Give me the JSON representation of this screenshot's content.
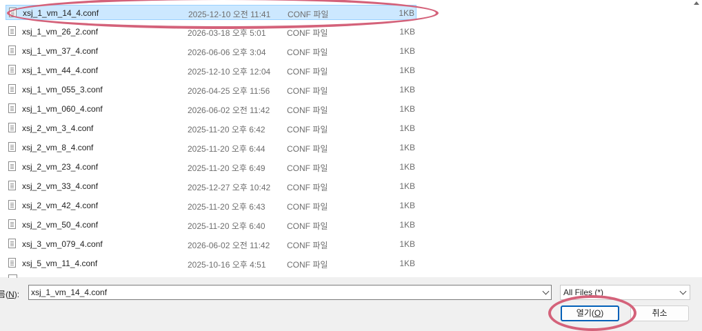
{
  "files": [
    {
      "name": "xsj_1_vm_14_4.conf",
      "date": "2025-12-10 오전 11:41",
      "type": "CONF 파일",
      "size": "1KB",
      "selected": true
    },
    {
      "name": "xsj_1_vm_26_2.conf",
      "date": "2026-03-18 오후 5:01",
      "type": "CONF 파일",
      "size": "1KB"
    },
    {
      "name": "xsj_1_vm_37_4.conf",
      "date": "2026-06-06 오후 3:04",
      "type": "CONF 파일",
      "size": "1KB"
    },
    {
      "name": "xsj_1_vm_44_4.conf",
      "date": "2025-12-10 오후 12:04",
      "type": "CONF 파일",
      "size": "1KB"
    },
    {
      "name": "xsj_1_vm_055_3.conf",
      "date": "2026-04-25 오후 11:56",
      "type": "CONF 파일",
      "size": "1KB"
    },
    {
      "name": "xsj_1_vm_060_4.conf",
      "date": "2026-06-02 오전 11:42",
      "type": "CONF 파일",
      "size": "1KB"
    },
    {
      "name": "xsj_2_vm_3_4.conf",
      "date": "2025-11-20 오후 6:42",
      "type": "CONF 파일",
      "size": "1KB"
    },
    {
      "name": "xsj_2_vm_8_4.conf",
      "date": "2025-11-20 오후 6:44",
      "type": "CONF 파일",
      "size": "1KB"
    },
    {
      "name": "xsj_2_vm_23_4.conf",
      "date": "2025-11-20 오후 6:49",
      "type": "CONF 파일",
      "size": "1KB"
    },
    {
      "name": "xsj_2_vm_33_4.conf",
      "date": "2025-12-27 오후 10:42",
      "type": "CONF 파일",
      "size": "1KB"
    },
    {
      "name": "xsj_2_vm_42_4.conf",
      "date": "2025-11-20 오후 6:43",
      "type": "CONF 파일",
      "size": "1KB"
    },
    {
      "name": "xsj_2_vm_50_4.conf",
      "date": "2025-11-20 오후 6:40",
      "type": "CONF 파일",
      "size": "1KB"
    },
    {
      "name": "xsj_3_vm_079_4.conf",
      "date": "2026-06-02 오전 11:42",
      "type": "CONF 파일",
      "size": "1KB"
    },
    {
      "name": "xsj_5_vm_11_4.conf",
      "date": "2025-10-16 오후 4:51",
      "type": "CONF 파일",
      "size": "1KB"
    }
  ],
  "filename": {
    "label": "파일 이름(N):",
    "label_prefix": "이름(",
    "label_key": "N",
    "label_suffix": "):",
    "value": "xsj_1_vm_14_4.conf"
  },
  "filter": {
    "value": "All Files (*)"
  },
  "buttons": {
    "open_prefix": "열기(",
    "open_key": "O",
    "open_suffix": ")",
    "cancel": "취소"
  },
  "colors": {
    "selection": "#cce8ff",
    "selection_border": "#99d1ff",
    "annotation": "#d4627a",
    "default_button_border": "#005fb8"
  }
}
